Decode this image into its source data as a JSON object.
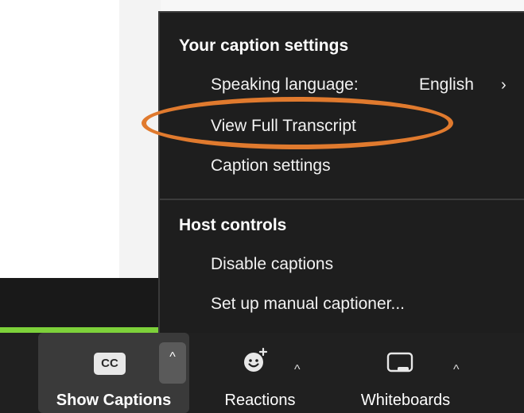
{
  "menu": {
    "caption_section_title": "Your caption settings",
    "speaking_language_label": "Speaking language:",
    "speaking_language_value": "English",
    "view_transcript_label": "View Full Transcript",
    "caption_settings_label": "Caption settings",
    "host_section_title": "Host controls",
    "disable_captions_label": "Disable captions",
    "manual_captioner_label": "Set up manual captioner..."
  },
  "toolbar": {
    "captions_icon_text": "CC",
    "show_captions_label": "Show Captions",
    "reactions_label": "Reactions",
    "whiteboards_label": "Whiteboards"
  },
  "icons": {
    "language_chevron": "chevron-right-icon",
    "captions_more": "chevron-up-icon",
    "reactions": "emoji-add-icon",
    "whiteboards": "whiteboard-icon"
  },
  "colors": {
    "highlight_ring": "#e07a2e",
    "active_speaker_bar": "#7dd13a",
    "menu_background": "#1e1e1e"
  }
}
